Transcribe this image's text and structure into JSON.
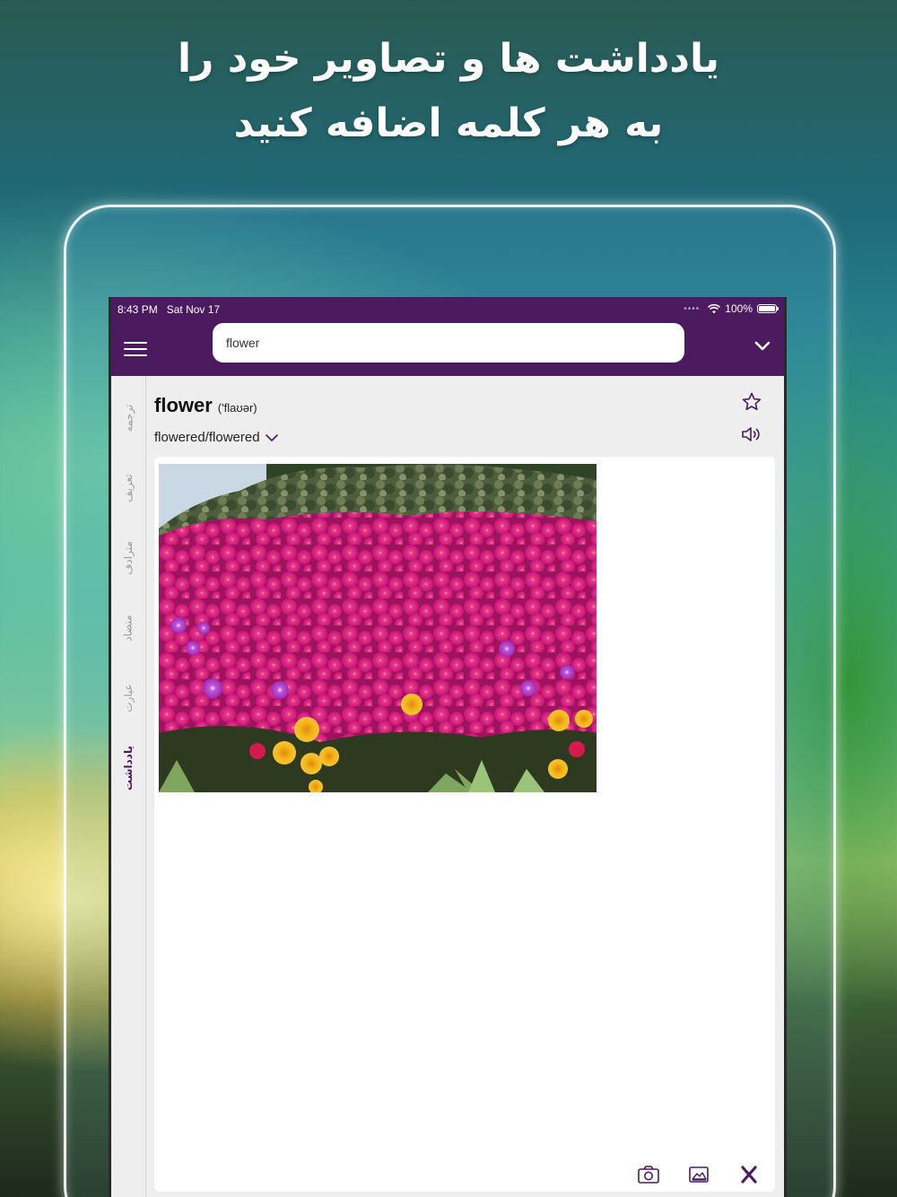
{
  "headline": {
    "line1": "یادداشت ها و تصاویر خود را",
    "line2": "به هر کلمه اضافه کنید"
  },
  "status_bar": {
    "time": "8:43 PM",
    "date": "Sat Nov 17",
    "battery": "100%"
  },
  "search": {
    "value": "flower"
  },
  "entry": {
    "word": "flower",
    "phonetic": "('flaʊər)",
    "forms": "flowered/flowered"
  },
  "tabs": [
    {
      "label": "ترجمه"
    },
    {
      "label": "تعریف"
    },
    {
      "label": "مترادف"
    },
    {
      "label": "متضاد"
    },
    {
      "label": "عبارت"
    },
    {
      "label": "یادداشت",
      "active": true
    }
  ],
  "colors": {
    "brand": "#4c1a5e",
    "flower_magenta": "#d0197a",
    "flower_yellow": "#f2b21a"
  },
  "icons": {
    "menu": "hamburger-icon",
    "collapse": "chevron-down-icon",
    "favorite": "star-icon",
    "pronounce": "speaker-icon",
    "camera": "camera-icon",
    "gallery": "image-icon",
    "close": "close-icon"
  }
}
